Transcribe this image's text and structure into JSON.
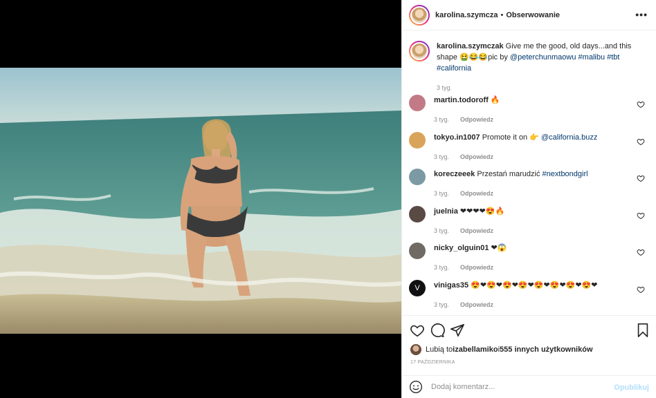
{
  "post": {
    "author": "karolina.szymcza",
    "separator": "•",
    "follow_label": "Obserwowanie",
    "more_label": "•••"
  },
  "caption": {
    "user": "karolina.szymczak",
    "text_before": " Give me the good, old days...and this shape 🤮😂😂pic by ",
    "mention": "@peterchunmaowu",
    "tags": " #malibu #tbt #california",
    "time": "3 tyg."
  },
  "comments": [
    {
      "user": "martin.todoroff",
      "text": " 🔥",
      "extra": "",
      "time": "3 tyg.",
      "reply": "Odpowiedz",
      "avatar_color": "#c27b86"
    },
    {
      "user": "tokyo.in1007",
      "text": " Promote it on 👉 ",
      "extra": "@california.buzz",
      "time": "3 tyg.",
      "reply": "Odpowiedz",
      "avatar_color": "#d9a45a"
    },
    {
      "user": "koreczeeek",
      "text": " Przestań marudzić ",
      "extra": "#nextbondgirl",
      "time": "3 tyg.",
      "reply": "Odpowiedz",
      "avatar_color": "#7c9aa3"
    },
    {
      "user": "juelnia",
      "text": " ❤❤❤❤😍🔥",
      "extra": "",
      "time": "3 tyg.",
      "reply": "Odpowiedz",
      "avatar_color": "#5a4a44"
    },
    {
      "user": "nicky_olguin01",
      "text": " ❤😱",
      "extra": "",
      "time": "3 tyg.",
      "reply": "Odpowiedz",
      "avatar_color": "#6f6a63"
    },
    {
      "user": "vinigas35",
      "text": " 😍❤😍❤😍❤😍❤😍❤😍❤😍❤😍❤",
      "extra": "",
      "time": "3 tyg.",
      "reply": "Odpowiedz",
      "avatar_color": "#111111",
      "avatar_letter": "V"
    }
  ],
  "likes": {
    "prefix": "Lubią to ",
    "user": "izabellamiko",
    "middle": " i ",
    "count": "555 innych użytkowników"
  },
  "date": "17 PAŹDZIERNIKA",
  "add_comment": {
    "placeholder": "Dodaj komentarz...",
    "publish_label": "Opublikuj"
  },
  "icons": {
    "header_avatar": "avatar",
    "more": "more-options-icon",
    "like": "heart-icon",
    "comment": "comment-icon",
    "share": "share-icon",
    "save": "bookmark-icon",
    "emoji": "emoji-icon"
  },
  "colors": {
    "link": "#00376b",
    "muted": "#8e8e8e",
    "publish_disabled": "#b2dffc"
  }
}
